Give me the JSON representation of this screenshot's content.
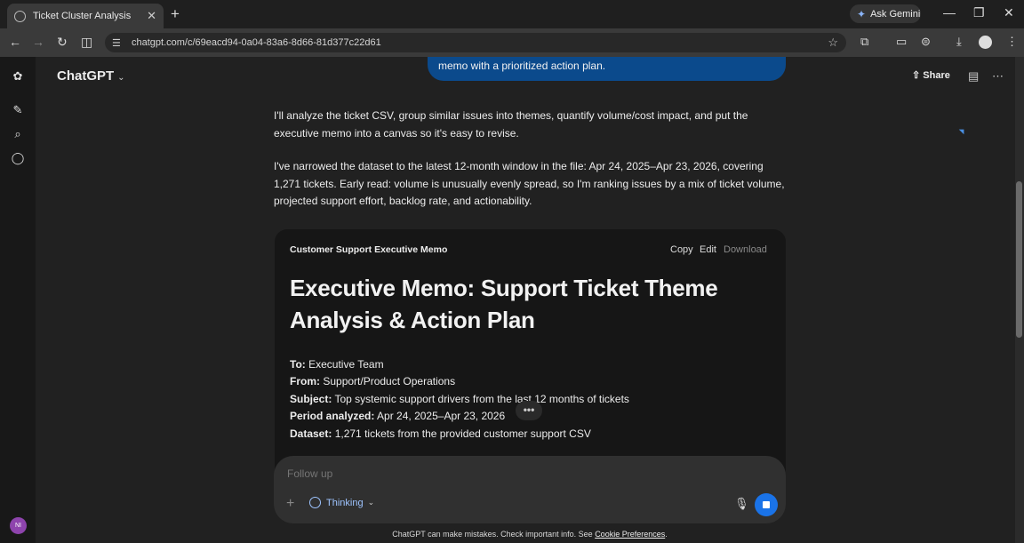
{
  "browser": {
    "tab_title": "Ticket Cluster Analysis",
    "url": "chatgpt.com/c/69eacd94-0a04-83a6-8d66-81d377c22d61",
    "ask_gemini": "Ask Gemini"
  },
  "app": {
    "brand": "ChatGPT",
    "share_label": "Share",
    "user_initials": "NI"
  },
  "conversation": {
    "user_message_tail": "memo with a prioritized action plan.",
    "assistant_para_1": "I'll analyze the ticket CSV, group similar issues into themes, quantify volume/cost impact, and put the executive memo into a canvas so it's easy to revise.",
    "assistant_para_2": "I've narrowed the dataset to the latest 12-month window in the file: Apr 24, 2025–Apr 23, 2026, covering 1,271 tickets. Early read: volume is unusually evenly spread, so I'm ranking issues by a mix of ticket volume, projected support effort, backlog rate, and actionability."
  },
  "canvas": {
    "title": "Customer Support Executive Memo",
    "copy": "Copy",
    "edit": "Edit",
    "download": "Download",
    "heading": "Executive Memo: Support Ticket Theme Analysis & Action Plan",
    "fields": [
      {
        "label": "To:",
        "value": "Executive Team"
      },
      {
        "label": "From:",
        "value": "Support/Product Operations"
      },
      {
        "label": "Subject:",
        "value": "Top systemic support drivers from the last 12 months of tickets"
      },
      {
        "label": "Period analyzed:",
        "value": "Apr 24, 2025–Apr 23, 2026"
      },
      {
        "label": "Dataset:",
        "value": "1,271 tickets from the provided customer support CSV"
      }
    ]
  },
  "composer": {
    "placeholder": "Follow up",
    "mode": "Thinking"
  },
  "footer": {
    "disclaimer": "ChatGPT can make mistakes. Check important info. See",
    "link": "Cookie Preferences",
    "end": "."
  }
}
